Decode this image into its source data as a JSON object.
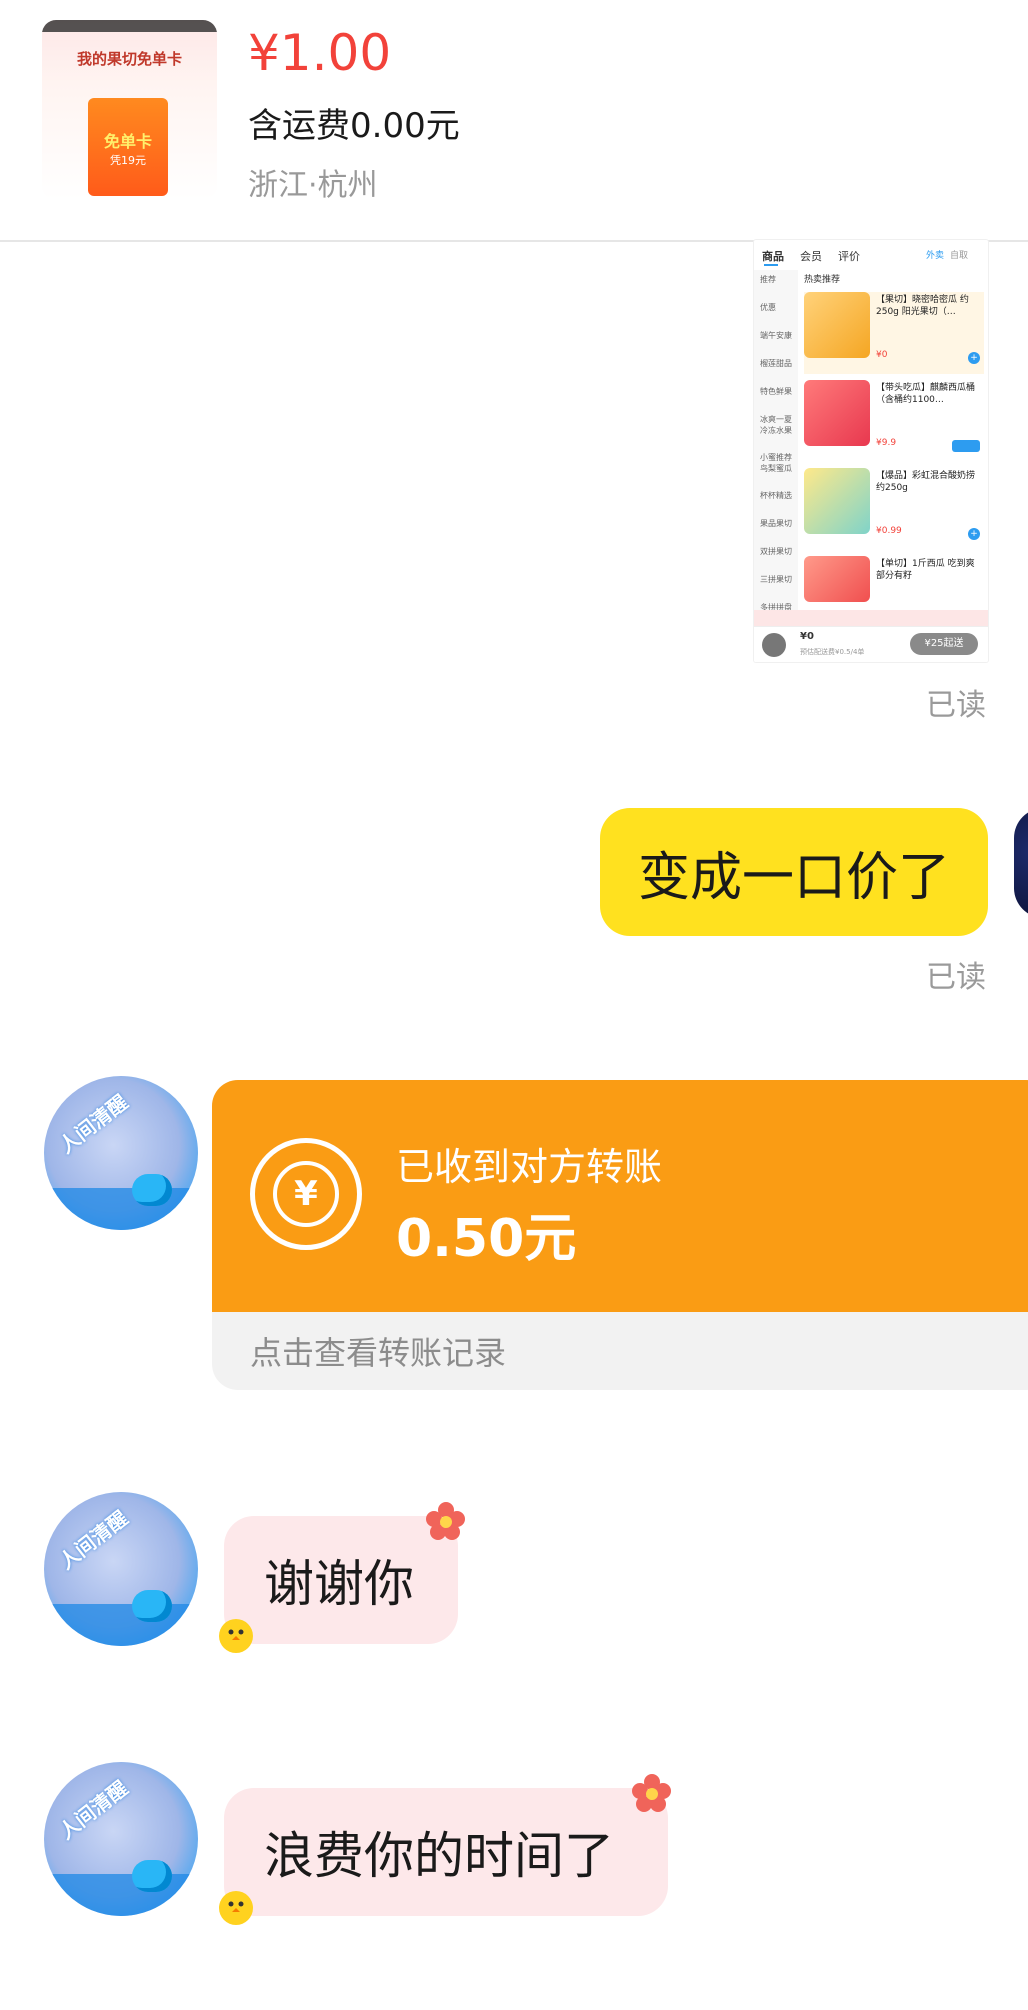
{
  "product": {
    "thumb_title": "我的果切免单卡",
    "thumb_card_label": "免单卡",
    "thumb_card_sub": "凭19元",
    "price": "¥1.00",
    "shipping": "含运费0.00元",
    "location": "浙江·杭州"
  },
  "shared_image": {
    "tabs": [
      "商品",
      "会员",
      "评价"
    ],
    "right_tabs": [
      "外卖",
      "自取"
    ],
    "section_title": "热卖推荐",
    "sidebar": [
      "推荐",
      "优惠",
      "端午安康",
      "榴莲甜品",
      "特色鲜果",
      "冰爽一夏 冷冻水果",
      "小蜜推荐 鸟梨蜜瓜",
      "杯杯精选",
      "果品果切",
      "双拼果切",
      "三拼果切",
      "多拼拼盘"
    ],
    "items": [
      {
        "name": "【果切】晓密哈密瓜 约250g 阳光果切（…",
        "price": "¥0"
      },
      {
        "name": "【带头吃瓜】麒麟西瓜桶（含桶约1100…",
        "price": "¥9.9"
      },
      {
        "name": "【爆品】彩虹混合酸奶捞 约250g",
        "price": "¥0.99"
      },
      {
        "name": "【单切】1斤西瓜 吃到爽 部分有籽",
        "price": ""
      }
    ],
    "footer_price": "¥0",
    "footer_note": "预估配送费¥0.5/4单",
    "footer_button": "¥25起送"
  },
  "read_receipt": "已读",
  "outgoing_message": "变成一口价了",
  "transfer": {
    "status": "已收到对方转账",
    "amount": "0.50元",
    "link": "点击查看转账记录",
    "icon_glyph": "¥"
  },
  "avatar_ring_text": "人间清醒",
  "incoming_messages": [
    "谢谢你",
    "浪费你的时间了"
  ],
  "colors": {
    "price_red": "#f2423a",
    "outgoing_yellow": "#ffe11f",
    "transfer_orange": "#fa9c14",
    "incoming_pink": "#fde8ea"
  }
}
